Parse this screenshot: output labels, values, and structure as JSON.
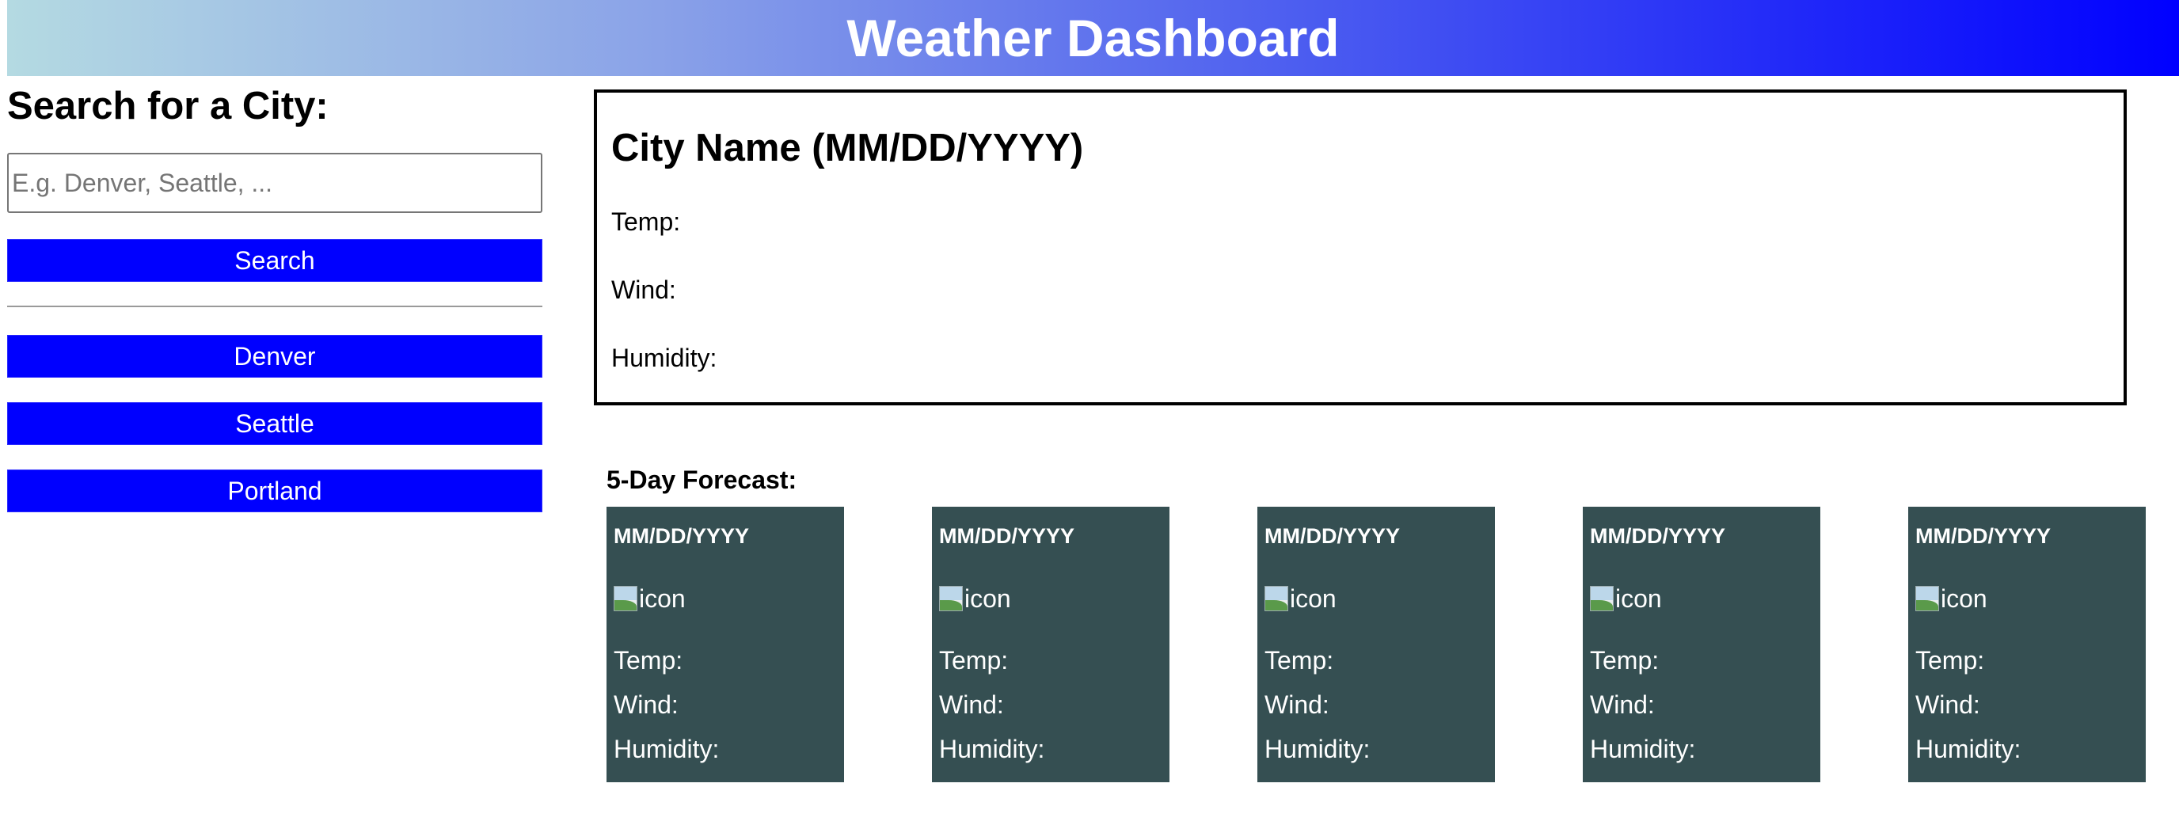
{
  "header": {
    "title": "Weather Dashboard"
  },
  "sidebar": {
    "heading": "Search for a City:",
    "search_placeholder": "E.g. Denver, Seattle, ...",
    "search_value": "",
    "search_button": "Search",
    "history": [
      {
        "label": "Denver"
      },
      {
        "label": "Seattle"
      },
      {
        "label": "Portland"
      }
    ]
  },
  "current": {
    "title": "City Name (MM/DD/YYYY)",
    "temp_label": "Temp:",
    "wind_label": "Wind:",
    "humidity_label": "Humidity:"
  },
  "forecast": {
    "title": "5-Day Forecast:",
    "cards": [
      {
        "date": "MM/DD/YYYY",
        "icon_alt": "icon",
        "icon": "broken-image-icon",
        "temp": "Temp:",
        "wind": "Wind:",
        "humidity": "Humidity:"
      },
      {
        "date": "MM/DD/YYYY",
        "icon_alt": "icon",
        "icon": "broken-image-icon",
        "temp": "Temp:",
        "wind": "Wind:",
        "humidity": "Humidity:"
      },
      {
        "date": "MM/DD/YYYY",
        "icon_alt": "icon",
        "icon": "broken-image-icon",
        "temp": "Temp:",
        "wind": "Wind:",
        "humidity": "Humidity:"
      },
      {
        "date": "MM/DD/YYYY",
        "icon_alt": "icon",
        "icon": "broken-image-icon",
        "temp": "Temp:",
        "wind": "Wind:",
        "humidity": "Humidity:"
      },
      {
        "date": "MM/DD/YYYY",
        "icon_alt": "icon",
        "icon": "broken-image-icon",
        "temp": "Temp:",
        "wind": "Wind:",
        "humidity": "Humidity:"
      }
    ]
  },
  "colors": {
    "button": "#0000ff",
    "card": "#354f52",
    "header_gradient_start": "#b4dae2",
    "header_gradient_end": "#0000ff"
  }
}
